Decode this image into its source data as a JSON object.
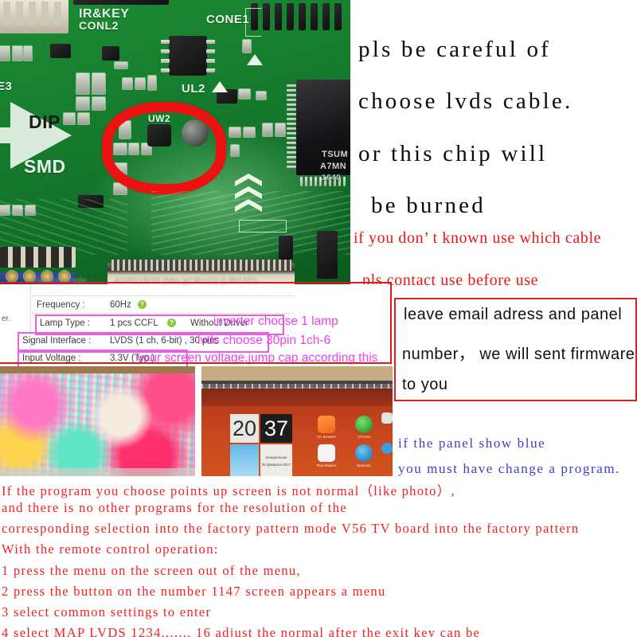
{
  "pcb_photo": {
    "alt": "close-up photo of TV mainboard PCB with red circle around voltage selection jumper",
    "silkscreen_labels": [
      "IR&KEY",
      "CONL2",
      "CONE1",
      "UL2",
      "UW2",
      "DIP",
      "SMD",
      "E3"
    ],
    "chip_markings": [
      "TSUM",
      "A7MN",
      "1640"
    ],
    "annotation_shape": "red-hand-drawn-circle"
  },
  "headline": {
    "color": "#0b0b0b",
    "lines": [
      "pls be careful of",
      "choose lvds cable.",
      "or this chip will",
      "be burned"
    ]
  },
  "red_notice": {
    "color": "#f01414",
    "lines": [
      "if you don’ t known use which cable",
      "pls contact use before use"
    ]
  },
  "spec_table": {
    "rows": [
      {
        "label": "Viewing Angle :",
        "value": "40/40/15/30 (Min.)(CR≥10) (L/R/U/D)",
        "has_help": false,
        "highlighted": false,
        "blurred": true,
        "extra": ""
      },
      {
        "label": "Frequency :",
        "value": "60Hz",
        "has_help": true,
        "highlighted": false,
        "blurred": false,
        "extra": ""
      },
      {
        "label": "Lamp Type :",
        "value": "1 pcs CCFL",
        "has_help": true,
        "highlighted": true,
        "blurred": false,
        "extra": "Without Driver"
      },
      {
        "label": "Signal Interface :",
        "value": "LVDS (1 ch, 6-bit) , 30 pins",
        "has_help": false,
        "highlighted": true,
        "blurred": false,
        "extra": ""
      },
      {
        "label": "Input Voltage :",
        "value": "3.3V (Typ.)",
        "has_help": false,
        "highlighted": true,
        "blurred": false,
        "extra": ""
      }
    ],
    "left_fragment": "er.",
    "highlight_color": "#e75fe7"
  },
  "magenta_notes": {
    "color": "#ee3fee",
    "lines": [
      "inverter choose 1 lamp",
      "lvds choose 30pin 1ch-6",
      "your screen voltage.jump cap according this"
    ]
  },
  "photo_left": {
    "alt": "TV screen showing distorted rainbow coloured picture - abnormal output"
  },
  "photo_right": {
    "alt": "TV screen showing Android launcher with clock widget",
    "clock_hours": "20",
    "clock_minutes": "37",
    "date_text": "20 февраля 2017",
    "day_text": "понедельник",
    "app_labels": [
      "UC Browser",
      "Chrome",
      "Play Маркет",
      "Браузер"
    ]
  },
  "email_box": {
    "border_color": "#e02020",
    "lines": [
      "leave email adress and panel",
      "number， we will sent  firmware",
      "to you"
    ]
  },
  "blue_notice": {
    "color": "#3b3fcf",
    "lines": [
      "if the panel show blue",
      "you must have change a program."
    ]
  },
  "bottom_paragraph": {
    "color": "#f41f1f",
    "lines": [
      "If the program you choose points up screen is not normal（like photo）,",
      "and there is no other programs for the resolution of the",
      "corresponding selection into the factory pattern mode V56 TV board into the factory pattern",
      "With the remote control operation:",
      "1 press the menu on the screen out of the menu,",
      "2 press the button on the number 1147 screen appears a menu",
      "3 select common settings to enter",
      "4 select MAP LVDS 1234....... 16 adjust the normal after the exit key can be"
    ]
  }
}
